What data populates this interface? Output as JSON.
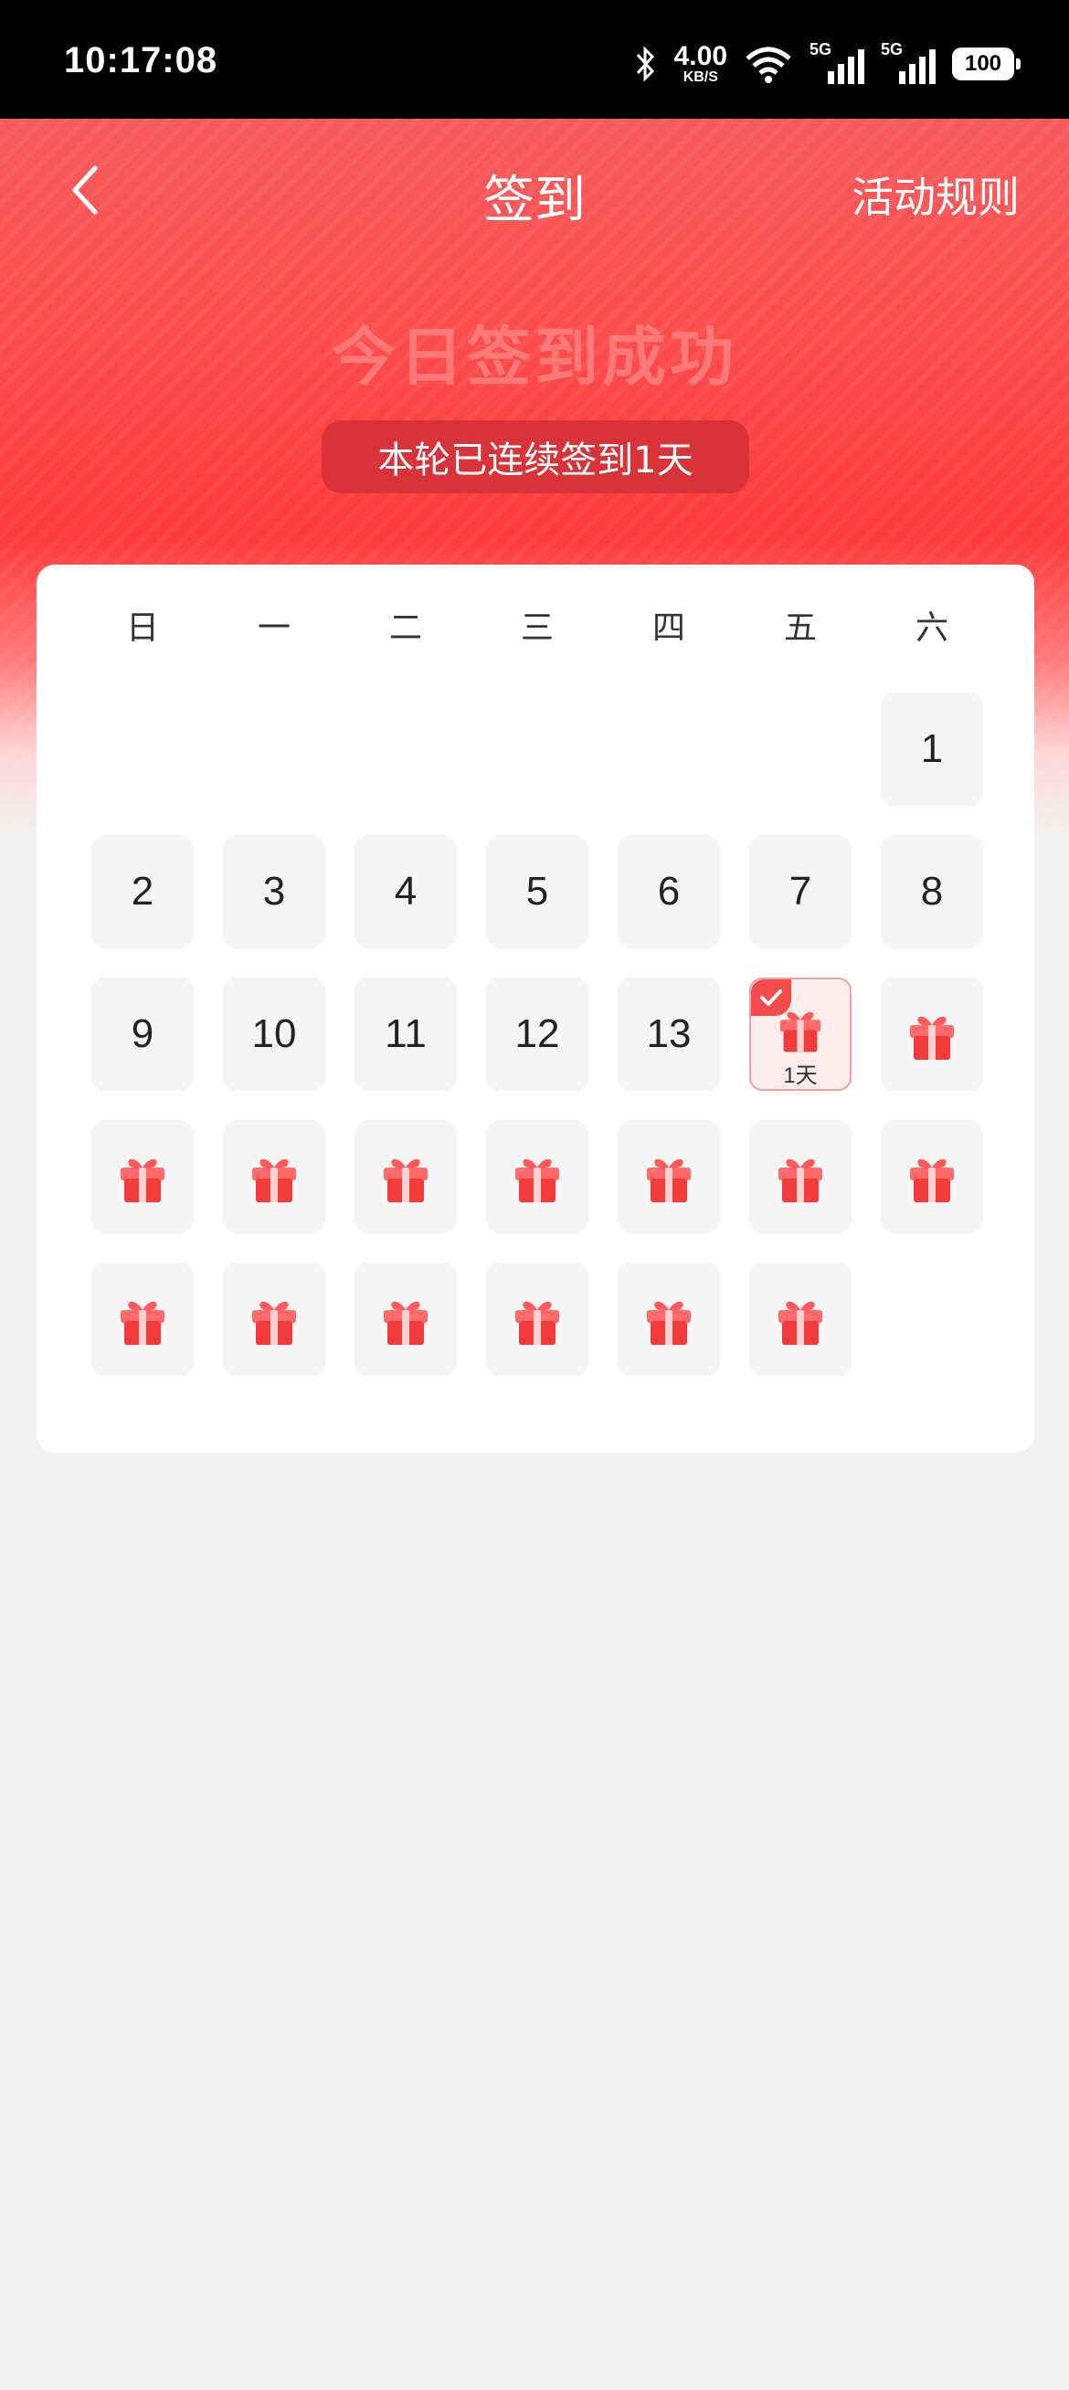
{
  "status": {
    "time": "10:17:08",
    "speed_value": "4.00",
    "speed_unit": "KB/S",
    "sim1": "5G",
    "sim2": "5G",
    "battery": "100"
  },
  "header": {
    "title": "签到",
    "rules": "活动规则"
  },
  "hero": {
    "success_text": "今日签到成功",
    "streak_text": "本轮已连续签到1天"
  },
  "calendar": {
    "weekdays": [
      "日",
      "一",
      "二",
      "三",
      "四",
      "五",
      "六"
    ],
    "days": [
      {
        "day": "1",
        "col": 6,
        "row": 0,
        "state": "past"
      },
      {
        "day": "2",
        "col": 0,
        "row": 1,
        "state": "past"
      },
      {
        "day": "3",
        "col": 1,
        "row": 1,
        "state": "past"
      },
      {
        "day": "4",
        "col": 2,
        "row": 1,
        "state": "past"
      },
      {
        "day": "5",
        "col": 3,
        "row": 1,
        "state": "past"
      },
      {
        "day": "6",
        "col": 4,
        "row": 1,
        "state": "past"
      },
      {
        "day": "7",
        "col": 5,
        "row": 1,
        "state": "past"
      },
      {
        "day": "8",
        "col": 6,
        "row": 1,
        "state": "past"
      },
      {
        "day": "9",
        "col": 0,
        "row": 2,
        "state": "past"
      },
      {
        "day": "10",
        "col": 1,
        "row": 2,
        "state": "past"
      },
      {
        "day": "11",
        "col": 2,
        "row": 2,
        "state": "past"
      },
      {
        "day": "12",
        "col": 3,
        "row": 2,
        "state": "past"
      },
      {
        "day": "13",
        "col": 4,
        "row": 2,
        "state": "past"
      },
      {
        "day": "",
        "col": 5,
        "row": 2,
        "state": "today",
        "label": "1天"
      },
      {
        "day": "",
        "col": 6,
        "row": 2,
        "state": "future"
      },
      {
        "day": "",
        "col": 0,
        "row": 3,
        "state": "future"
      },
      {
        "day": "",
        "col": 1,
        "row": 3,
        "state": "future"
      },
      {
        "day": "",
        "col": 2,
        "row": 3,
        "state": "future"
      },
      {
        "day": "",
        "col": 3,
        "row": 3,
        "state": "future"
      },
      {
        "day": "",
        "col": 4,
        "row": 3,
        "state": "future"
      },
      {
        "day": "",
        "col": 5,
        "row": 3,
        "state": "future"
      },
      {
        "day": "",
        "col": 6,
        "row": 3,
        "state": "future"
      },
      {
        "day": "",
        "col": 0,
        "row": 4,
        "state": "future"
      },
      {
        "day": "",
        "col": 1,
        "row": 4,
        "state": "future"
      },
      {
        "day": "",
        "col": 2,
        "row": 4,
        "state": "future"
      },
      {
        "day": "",
        "col": 3,
        "row": 4,
        "state": "future"
      },
      {
        "day": "",
        "col": 4,
        "row": 4,
        "state": "future"
      },
      {
        "day": "",
        "col": 5,
        "row": 4,
        "state": "future"
      }
    ]
  },
  "colors": {
    "accent": "#ff3a3a",
    "streak_bg": "#d9333a",
    "gift": "#f23c3c"
  }
}
